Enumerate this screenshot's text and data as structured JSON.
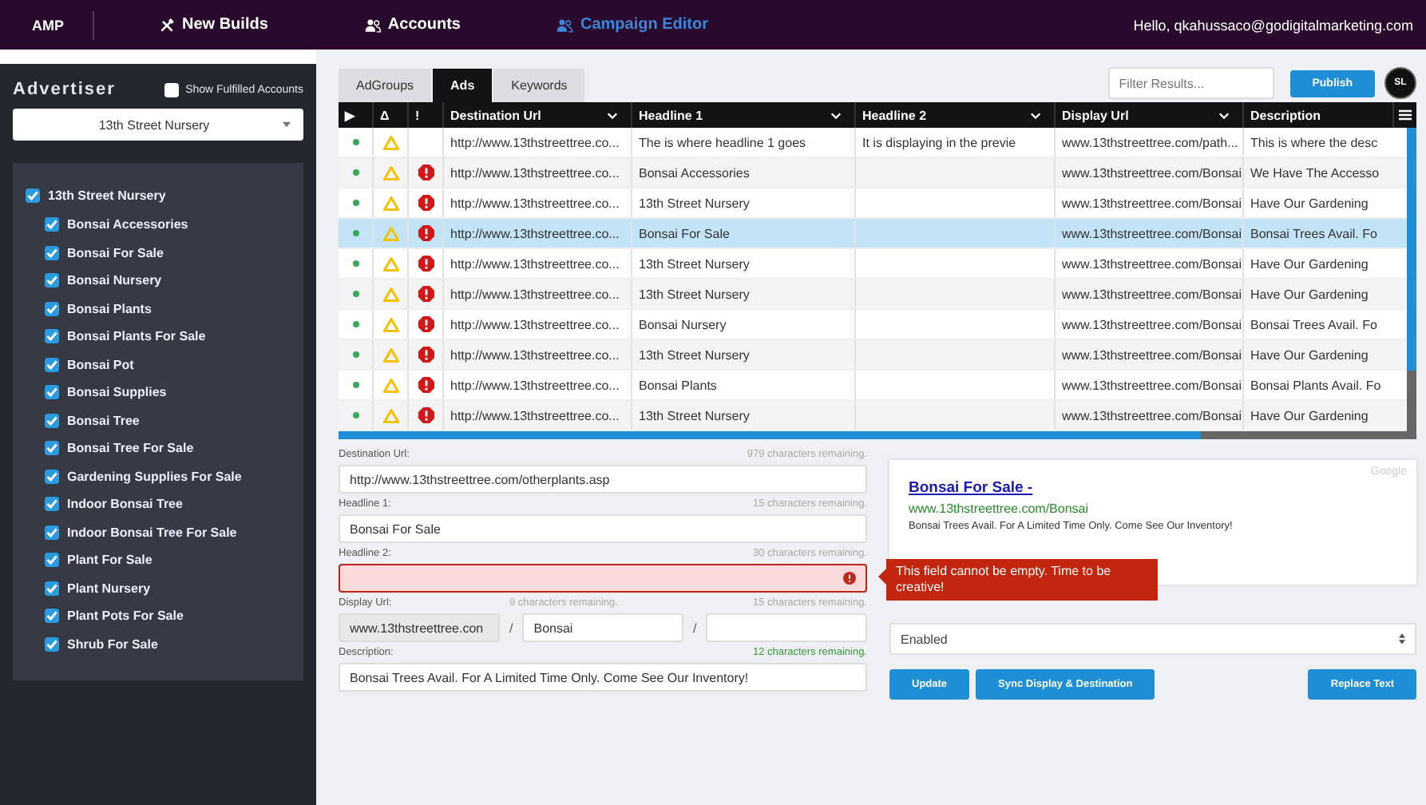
{
  "topbar": {
    "brand": "AMP",
    "nav": [
      {
        "label": "New Builds",
        "kind": "tools",
        "selected": false
      },
      {
        "label": "Accounts",
        "kind": "people",
        "selected": false
      },
      {
        "label": "Campaign Editor",
        "kind": "people",
        "selected": true
      }
    ],
    "greeting": "Hello, qkahussaco@godigitalmarketing.com"
  },
  "sidebar": {
    "title": "Advertiser",
    "show_fulfilled": {
      "label": "Show Fulfilled Accounts",
      "checked": false
    },
    "advertiser_select": "13th Street Nursery",
    "tree": {
      "label": "13th Street Nursery",
      "checked": true,
      "children": [
        {
          "label": "Bonsai Accessories",
          "checked": true
        },
        {
          "label": "Bonsai For Sale",
          "checked": true
        },
        {
          "label": "Bonsai Nursery",
          "checked": true
        },
        {
          "label": "Bonsai Plants",
          "checked": true
        },
        {
          "label": "Bonsai Plants For Sale",
          "checked": true
        },
        {
          "label": "Bonsai Pot",
          "checked": true
        },
        {
          "label": "Bonsai Supplies",
          "checked": true
        },
        {
          "label": "Bonsai Tree",
          "checked": true
        },
        {
          "label": "Bonsai Tree For Sale",
          "checked": true
        },
        {
          "label": "Gardening Supplies For Sale",
          "checked": true
        },
        {
          "label": "Indoor Bonsai Tree",
          "checked": true
        },
        {
          "label": "Indoor Bonsai Tree For Sale",
          "checked": true
        },
        {
          "label": "Plant For Sale",
          "checked": true
        },
        {
          "label": "Plant Nursery",
          "checked": true
        },
        {
          "label": "Plant Pots For Sale",
          "checked": true
        },
        {
          "label": "Shrub For Sale",
          "checked": true
        }
      ]
    }
  },
  "tabs": [
    {
      "label": "AdGroups",
      "selected": false
    },
    {
      "label": "Ads",
      "selected": true
    },
    {
      "label": "Keywords",
      "selected": false
    }
  ],
  "filter": {
    "placeholder": "Filter Results..."
  },
  "publish_button": "Publish",
  "avatar": "SL",
  "table": {
    "columns": [
      {
        "label": "▶",
        "sortable": false
      },
      {
        "label": "Δ",
        "sortable": false
      },
      {
        "label": "!",
        "sortable": false
      },
      {
        "label": "Destination Url",
        "sortable": true
      },
      {
        "label": "Headline 1",
        "sortable": true
      },
      {
        "label": "Headline 2",
        "sortable": true
      },
      {
        "label": "Display Url",
        "sortable": true
      },
      {
        "label": "Description",
        "sortable": false
      }
    ],
    "rows": [
      {
        "enabled": true,
        "warning": true,
        "error": false,
        "selected": false,
        "destination": "http://www.13thstreettree.co...",
        "headline_1": "The is where headline 1 goes",
        "headline_2": "It is displaying in the previe",
        "display_url": "www.13thstreettree.com/path...",
        "description": "This is where the desc"
      },
      {
        "enabled": true,
        "warning": true,
        "error": true,
        "selected": false,
        "destination": "http://www.13thstreettree.co...",
        "headline_1": "Bonsai Accessories",
        "display_url": "www.13thstreettree.com/Bonsai",
        "description": "We Have The Accesso"
      },
      {
        "enabled": true,
        "warning": true,
        "error": true,
        "selected": false,
        "destination": "http://www.13thstreettree.co...",
        "headline_1": "13th Street Nursery",
        "display_url": "www.13thstreettree.com/Bonsai",
        "description": "Have Our Gardening"
      },
      {
        "enabled": true,
        "warning": true,
        "error": true,
        "selected": true,
        "destination": "http://www.13thstreettree.co...",
        "headline_1": "Bonsai For Sale",
        "display_url": "www.13thstreettree.com/Bonsai",
        "description": "Bonsai Trees Avail. Fo"
      },
      {
        "enabled": true,
        "warning": true,
        "error": true,
        "selected": false,
        "destination": "http://www.13thstreettree.co...",
        "headline_1": "13th Street Nursery",
        "display_url": "www.13thstreettree.com/Bonsai",
        "description": "Have Our Gardening"
      },
      {
        "enabled": true,
        "warning": true,
        "error": true,
        "selected": false,
        "destination": "http://www.13thstreettree.co...",
        "headline_1": "13th Street Nursery",
        "display_url": "www.13thstreettree.com/Bonsai",
        "description": "Have Our Gardening"
      },
      {
        "enabled": true,
        "warning": true,
        "error": true,
        "selected": false,
        "destination": "http://www.13thstreettree.co...",
        "headline_1": "Bonsai Nursery",
        "display_url": "www.13thstreettree.com/Bonsai",
        "description": "Bonsai Trees Avail. Fo"
      },
      {
        "enabled": true,
        "warning": true,
        "error": true,
        "selected": false,
        "destination": "http://www.13thstreettree.co...",
        "headline_1": "13th Street Nursery",
        "display_url": "www.13thstreettree.com/Bonsai",
        "description": "Have Our Gardening"
      },
      {
        "enabled": true,
        "warning": true,
        "error": true,
        "selected": false,
        "destination": "http://www.13thstreettree.co...",
        "headline_1": "Bonsai Plants",
        "display_url": "www.13thstreettree.com/Bonsai",
        "description": "Bonsai Plants Avail. Fo"
      },
      {
        "enabled": true,
        "warning": true,
        "error": true,
        "selected": false,
        "destination": "http://www.13thstreettree.co...",
        "headline_1": "13th Street Nursery",
        "display_url": "www.13thstreettree.com/Bonsai",
        "description": "Have Our Gardening"
      }
    ]
  },
  "form": {
    "destination": {
      "label": "Destination Url:",
      "remaining": "979 characters remaining.",
      "value": "http://www.13thstreettree.com/otherplants.asp"
    },
    "headline_1": {
      "label": "Headline 1:",
      "remaining": "15 characters remaining.",
      "value": "Bonsai For Sale"
    },
    "headline_2": {
      "label": "Headline 2:",
      "remaining": "30 characters remaining.",
      "error": true,
      "error_message": "This field cannot be empty. Time to be creative!"
    },
    "display_url": {
      "label": "Display Url:",
      "domain": "www.13thstreettree.con",
      "separator_1": "/",
      "path_1": "Bonsai",
      "path_1_remaining": "9 characters remaining.",
      "separator_2": "/",
      "path_2_remaining": "15 characters remaining."
    },
    "description": {
      "label": "Description:",
      "remaining": "12 characters remaining.",
      "remaining_ok": true,
      "value": "Bonsai Trees Avail. For A Limited Time Only. Come See Our Inventory!"
    }
  },
  "preview": {
    "engine": "Google",
    "title": "Bonsai For Sale -",
    "url": "www.13thstreettree.com/Bonsai",
    "description": "Bonsai Trees Avail. For A Limited Time Only. Come See Our Inventory!"
  },
  "status_select": "Enabled",
  "buttons": [
    "Update",
    "Sync Display & Destination",
    "Replace Text"
  ]
}
